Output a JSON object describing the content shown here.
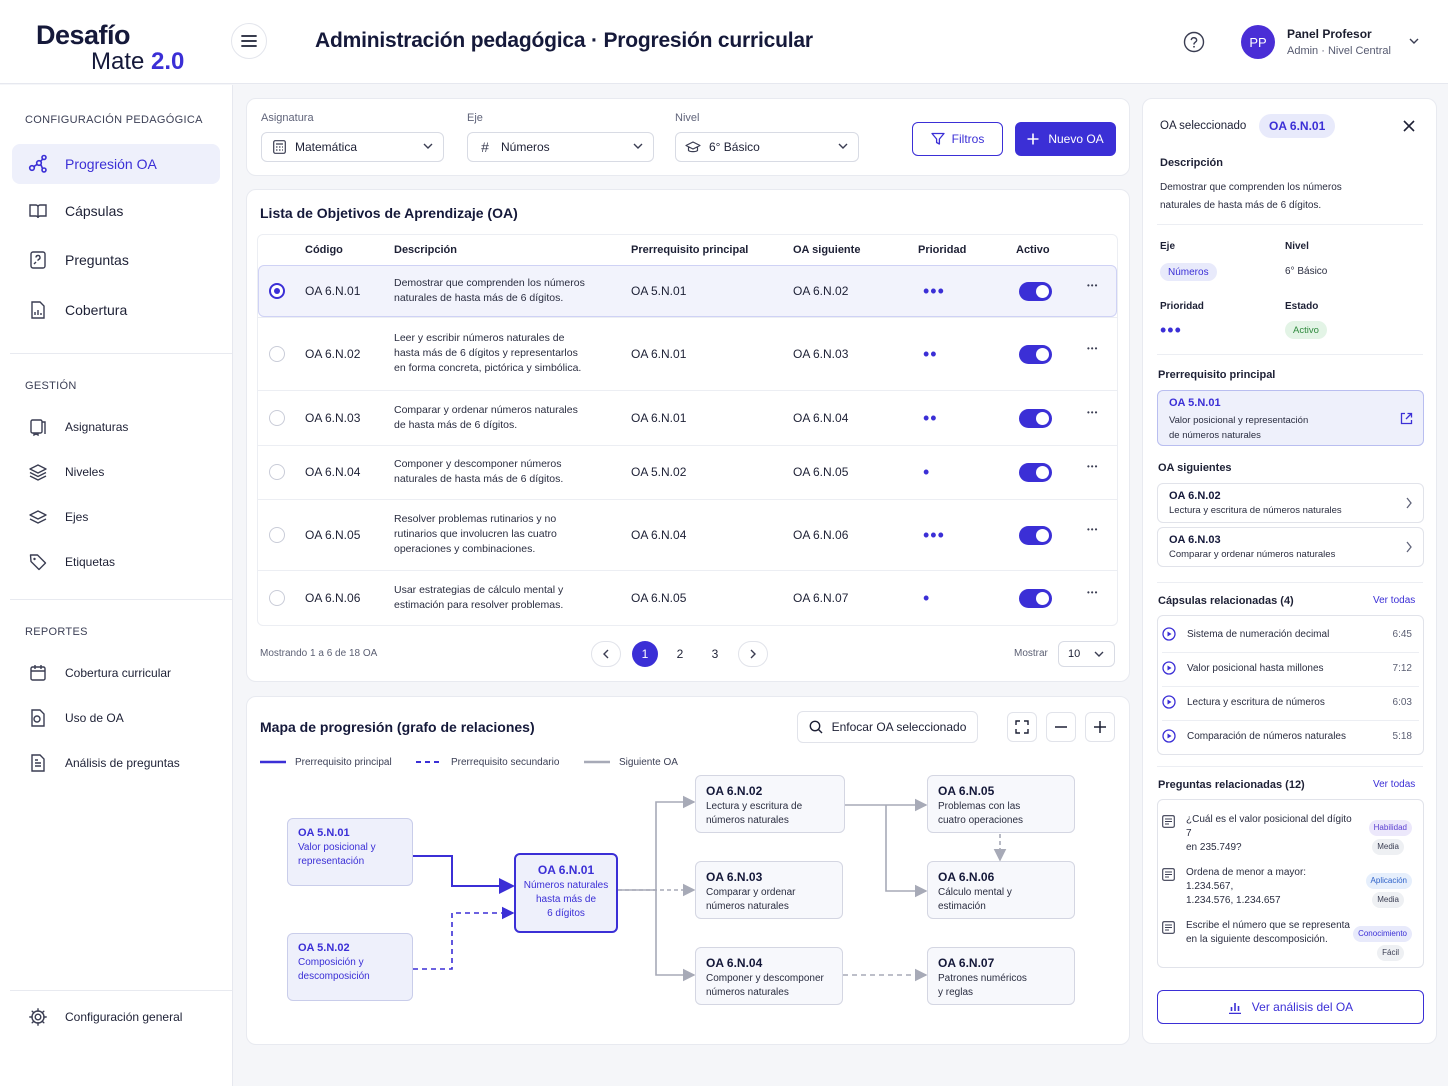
{
  "app": {
    "logo_line1": "Desafío",
    "logo_line2": "Mate",
    "logo_version": "2.0"
  },
  "header": {
    "title": "Administración pedagógica · Progresión curricular",
    "user_initials": "PP",
    "user_name": "Panel Profesor",
    "user_role": "Admin · Nivel Central"
  },
  "sidebar": {
    "section1": "CONFIGURACIÓN PEDAGÓGICA",
    "items1": [
      {
        "label": "Progresión OA",
        "icon": "graph-icon"
      },
      {
        "label": "Cápsulas",
        "icon": "book-icon"
      },
      {
        "label": "Preguntas",
        "icon": "question-icon"
      },
      {
        "label": "Cobertura",
        "icon": "chart-doc-icon"
      }
    ],
    "section2": "GESTIÓN",
    "items2": [
      {
        "label": "Asignaturas",
        "icon": "book-open-icon"
      },
      {
        "label": "Niveles",
        "icon": "layers-icon"
      },
      {
        "label": "Ejes",
        "icon": "stack-icon"
      },
      {
        "label": "Etiquetas",
        "icon": "tag-icon"
      }
    ],
    "section3": "REPORTES",
    "items3": [
      {
        "label": "Cobertura curricular",
        "icon": "calendar-icon"
      },
      {
        "label": "Uso de OA",
        "icon": "usage-doc-icon"
      },
      {
        "label": "Análisis de preguntas",
        "icon": "analysis-doc-icon"
      }
    ],
    "settings": "Configuración general"
  },
  "filters": {
    "subject_label": "Asignatura",
    "subject_value": "Matemática",
    "axis_label": "Eje",
    "axis_value": "Números",
    "level_label": "Nivel",
    "level_value": "6° Básico",
    "filters_button": "Filtros",
    "new_button": "Nuevo OA"
  },
  "table": {
    "title": "Lista de Objetivos de Aprendizaje (OA)",
    "headers": {
      "code": "Código",
      "description": "Descripción",
      "prereq": "Prerrequisito principal",
      "next": "OA siguiente",
      "priority": "Prioridad",
      "active": "Activo"
    },
    "rows": [
      {
        "code": "OA 6.N.01",
        "desc": [
          "Demostrar que comprenden los números",
          "naturales de hasta más de 6 dígitos."
        ],
        "prereq": "OA 5.N.01",
        "next": "OA 6.N.02",
        "priority": 3,
        "active": true,
        "selected": true
      },
      {
        "code": "OA 6.N.02",
        "desc": [
          "Leer y escribir números naturales de",
          "hasta más de 6 dígitos y representarlos",
          "en forma concreta, pictórica y simbólica."
        ],
        "prereq": "OA 6.N.01",
        "next": "OA 6.N.03",
        "priority": 2,
        "active": true,
        "selected": false
      },
      {
        "code": "OA 6.N.03",
        "desc": [
          "Comparar y ordenar números naturales",
          "de hasta más de 6 dígitos."
        ],
        "prereq": "OA 6.N.01",
        "next": "OA 6.N.04",
        "priority": 2,
        "active": true,
        "selected": false
      },
      {
        "code": "OA 6.N.04",
        "desc": [
          "Componer y descomponer números",
          "naturales de hasta más de 6 dígitos."
        ],
        "prereq": "OA 5.N.02",
        "next": "OA 6.N.05",
        "priority": 1,
        "active": true,
        "selected": false
      },
      {
        "code": "OA 6.N.05",
        "desc": [
          "Resolver problemas rutinarios y no",
          "rutinarios que involucren las cuatro",
          "operaciones y combinaciones."
        ],
        "prereq": "OA 6.N.04",
        "next": "OA 6.N.06",
        "priority": 3,
        "active": true,
        "selected": false
      },
      {
        "code": "OA 6.N.06",
        "desc": [
          "Usar estrategias de cálculo mental y",
          "estimación para resolver problemas."
        ],
        "prereq": "OA 6.N.05",
        "next": "OA 6.N.07",
        "priority": 1,
        "active": true,
        "selected": false
      }
    ],
    "showing": "Mostrando 1 a 6 de 18 OA",
    "pages": [
      "1",
      "2",
      "3"
    ],
    "current_page": "1",
    "show_label": "Mostrar",
    "page_size": "10"
  },
  "graph": {
    "title": "Mapa de progresión (grafo de relaciones)",
    "focus_button": "Enfocar OA seleccionado",
    "legend": {
      "primary": "Prerrequisito principal",
      "secondary": "Prerrequisito secundario",
      "next": "Siguiente OA"
    },
    "nodes": {
      "n5n01": {
        "code": "OA 5.N.01",
        "l1": "Valor posicional y",
        "l2": "representación"
      },
      "n5n02": {
        "code": "OA 5.N.02",
        "l1": "Composición y",
        "l2": "descomposición"
      },
      "main": {
        "code": "OA 6.N.01",
        "l1": "Números naturales",
        "l2": "hasta más de",
        "l3": "6 dígitos"
      },
      "n6n02": {
        "code": "OA 6.N.02",
        "l1": "Lectura y escritura de",
        "l2": "números naturales"
      },
      "n6n03": {
        "code": "OA 6.N.03",
        "l1": "Comparar y ordenar",
        "l2": "números naturales"
      },
      "n6n04": {
        "code": "OA 6.N.04",
        "l1": "Componer y descomponer",
        "l2": "números naturales"
      },
      "n6n05": {
        "code": "OA 6.N.05",
        "l1": "Problemas con las",
        "l2": "cuatro operaciones"
      },
      "n6n06": {
        "code": "OA 6.N.06",
        "l1": "Cálculo mental y",
        "l2": "estimación"
      },
      "n6n07": {
        "code": "OA 6.N.07",
        "l1": "Patrones numéricos",
        "l2": "y reglas"
      }
    }
  },
  "panel": {
    "selected_label": "OA seleccionado",
    "selected_code": "OA 6.N.01",
    "desc_label": "Descripción",
    "desc_l1": "Demostrar que comprenden los números",
    "desc_l2": "naturales de hasta más de 6 dígitos.",
    "axis_label": "Eje",
    "axis_value": "Números",
    "level_label": "Nivel",
    "level_value": "6° Básico",
    "priority_label": "Prioridad",
    "priority_value": 3,
    "status_label": "Estado",
    "status_value": "Activo",
    "prereq_label": "Prerrequisito principal",
    "prereq_code": "OA 5.N.01",
    "prereq_l1": "Valor posicional y representación",
    "prereq_l2": "de números naturales",
    "next_label": "OA siguientes",
    "next_items": [
      {
        "code": "OA 6.N.02",
        "desc": "Lectura y escritura de números naturales"
      },
      {
        "code": "OA 6.N.03",
        "desc": "Comparar y ordenar números naturales"
      }
    ],
    "capsules_label": "Cápsulas relacionadas (4)",
    "see_all": "Ver todas",
    "capsules": [
      {
        "title": "Sistema de numeración decimal",
        "duration": "6:45"
      },
      {
        "title": "Valor posicional hasta millones",
        "duration": "7:12"
      },
      {
        "title": "Lectura y escritura de números",
        "duration": "6:03"
      },
      {
        "title": "Comparación de números naturales",
        "duration": "5:18"
      }
    ],
    "questions_label": "Preguntas relacionadas (12)",
    "questions": [
      {
        "l1": "¿Cuál es el valor posicional del dígito 7",
        "l2": "en 235.749?",
        "tag": "Habilidad",
        "level": "Media"
      },
      {
        "l1": "Ordena de menor a mayor: 1.234.567,",
        "l2": "1.234.576, 1.234.657",
        "tag": "Aplicación",
        "level": "Media"
      },
      {
        "l1": "Escribe el número que se representa",
        "l2": "en la siguiente descomposición.",
        "tag": "Conocimiento",
        "level": "Fácil"
      }
    ],
    "analysis_button": "Ver análisis del OA"
  },
  "colors": {
    "accent": "#3b2fd6",
    "background": "#f5f6f9",
    "active_green": "#2f8a3e"
  }
}
